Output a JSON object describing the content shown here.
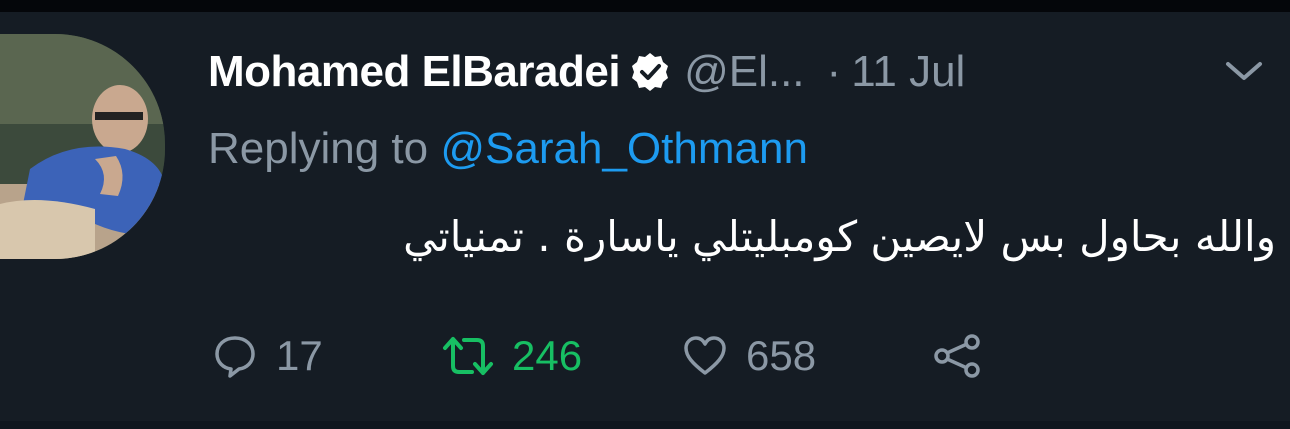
{
  "tweet": {
    "author": {
      "name": "Mohamed ElBaradei",
      "handle": "@El...",
      "verified": true
    },
    "separator": "·",
    "date": "11 Jul",
    "reply_prefix": "Replying to",
    "reply_to": "@Sarah_Othmann",
    "text": "والله بحاول بس لايصين كومبليتلي ياسارة . تمنياتي",
    "actions": {
      "reply_count": "17",
      "retweet_count": "246",
      "like_count": "658"
    }
  },
  "icons": {
    "verified": "verified-badge-icon",
    "more": "chevron-down-icon",
    "reply": "comment-bubble-icon",
    "retweet": "retweet-icon",
    "like": "heart-icon",
    "share": "share-icon"
  },
  "colors": {
    "background": "#15202b",
    "text_primary": "#ffffff",
    "text_secondary": "#8b98a5",
    "link": "#1d9bf0",
    "retweet_active": "#17bf63"
  }
}
